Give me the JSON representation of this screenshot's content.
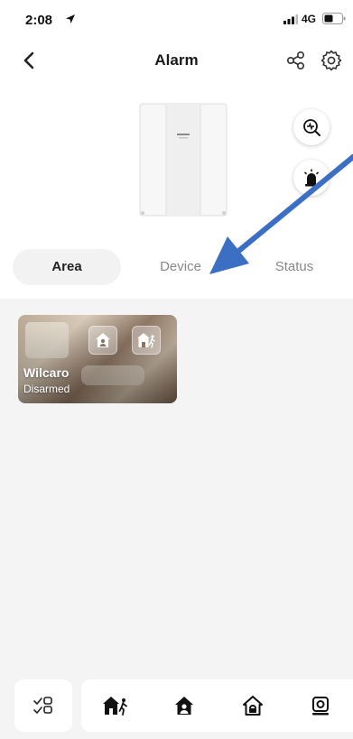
{
  "status_bar": {
    "time": "2:08",
    "network": "4G"
  },
  "nav": {
    "title": "Alarm",
    "icons": {
      "back": "chevron-left-icon",
      "share": "share-icon",
      "settings": "gear-icon"
    }
  },
  "device": {
    "actions": [
      "diagnostics-icon",
      "siren-icon"
    ]
  },
  "tabs": [
    {
      "label": "Area",
      "selected": true
    },
    {
      "label": "Device",
      "selected": false
    },
    {
      "label": "Status",
      "selected": false
    }
  ],
  "areas": [
    {
      "name": "Wilcaro",
      "status": "Disarmed",
      "actions": [
        "stay-arm-icon",
        "away-arm-icon"
      ]
    }
  ],
  "toolbar": {
    "items": [
      "multi-select-icon",
      "away-arm-icon",
      "stay-arm-icon",
      "disarm-icon",
      "clear-alarm-icon"
    ]
  },
  "colors": {
    "accent": "#111111",
    "annotation_arrow": "#3a6fc4",
    "content_bg": "#f4f4f4",
    "tab_selected_bg": "#f2f2f2"
  }
}
